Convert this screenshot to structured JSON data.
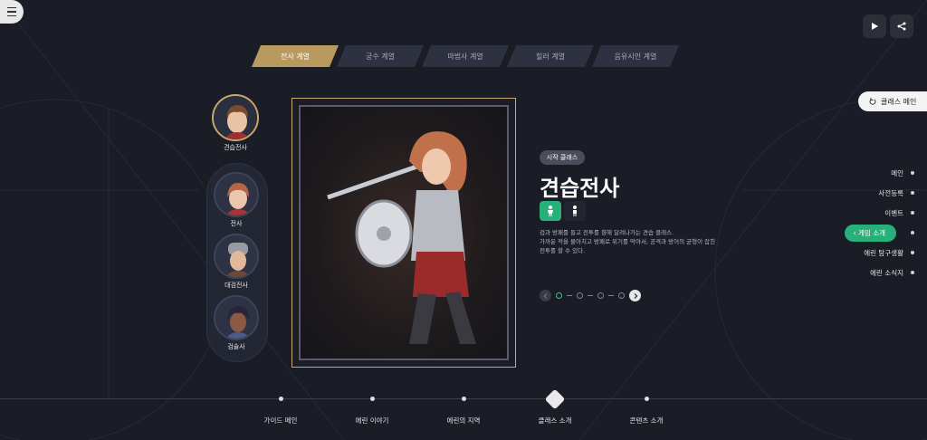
{
  "tabs": [
    {
      "label": "전사 계열",
      "active": true
    },
    {
      "label": "궁수 계열",
      "active": false
    },
    {
      "label": "마법사 계열",
      "active": false
    },
    {
      "label": "힐러 계열",
      "active": false
    },
    {
      "label": "음유시인 계열",
      "active": false
    }
  ],
  "class_main_button": "클래스 메인",
  "classes": {
    "base": {
      "label": "견습전사"
    },
    "sub": [
      {
        "label": "전사"
      },
      {
        "label": "대검전사"
      },
      {
        "label": "검술사"
      }
    ]
  },
  "detail": {
    "badge": "시작 클래스",
    "name": "견습전사",
    "description": [
      "검과 방패를 들고 전투를 향해 달려나가는 견습 클래스.",
      "가까운 적을 물아치고 방패로 위기를 막아서, 공격과 방어의 균형이 잡힌",
      "전투를 할 수 있다."
    ]
  },
  "right_nav": [
    {
      "label": "메인",
      "active": false
    },
    {
      "label": "사전등록",
      "active": false
    },
    {
      "label": "이벤트",
      "active": false
    },
    {
      "label": "게임 소개",
      "active": true
    },
    {
      "label": "에린 탐구생활",
      "active": false
    },
    {
      "label": "에린 소식지",
      "active": false
    }
  ],
  "bottom_nav": [
    {
      "label": "가이드 메인",
      "active": false
    },
    {
      "label": "에린 이야기",
      "active": false
    },
    {
      "label": "에린의 지역",
      "active": false
    },
    {
      "label": "클래스 소개",
      "active": true
    },
    {
      "label": "콘텐츠 소개",
      "active": false
    }
  ],
  "colors": {
    "background": "#1a1d25",
    "accent_gold": "#b89a5e",
    "accent_green": "#27b07a"
  }
}
